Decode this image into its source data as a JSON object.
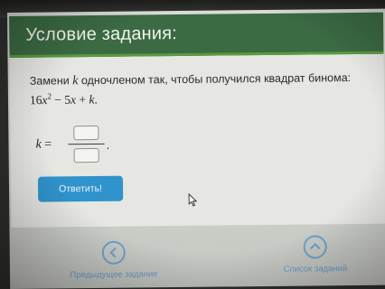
{
  "header": {
    "title": "Условие задания:"
  },
  "task": {
    "text_prefix": "Замени",
    "variable": "k",
    "text_suffix": "одночленом так, чтобы получился квадрат бинома:",
    "expression_parts": {
      "coef": "16",
      "var1": "x",
      "exp": "2",
      "minus": "− 5",
      "var2": "x",
      "plus": "+",
      "var3": "k",
      "end": "."
    }
  },
  "answer": {
    "variable": "k",
    "equals": "=",
    "numerator_value": "",
    "denominator_value": "",
    "trailing": "."
  },
  "buttons": {
    "submit_label": "Ответить!"
  },
  "navigation": {
    "prev_label": "Предыдущее задание",
    "list_label": "Список заданий"
  },
  "colors": {
    "header_bg": "#3b6a43",
    "header_accent": "#5b9a3e",
    "button_bg": "#2f93cc",
    "nav_color": "#6a9cc8"
  },
  "icons": {
    "prev": "chevron-left-icon",
    "list": "chevron-up-icon",
    "cursor": "mouse-pointer-icon"
  }
}
